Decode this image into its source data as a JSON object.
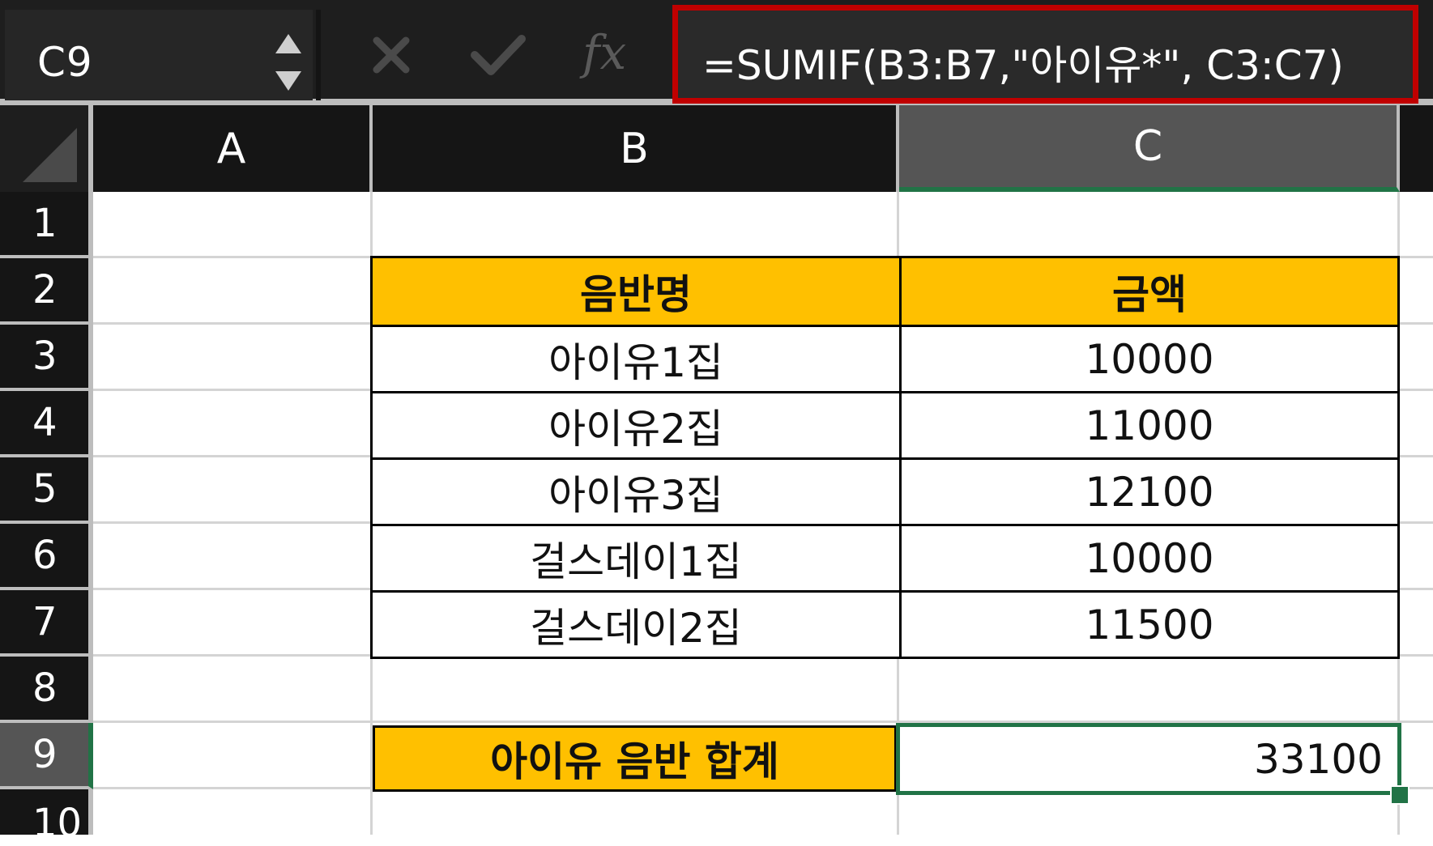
{
  "formula_bar": {
    "name_box": "C9",
    "formula": "=SUMIF(B3:B7,\"아이유*\", C3:C7)",
    "icons": [
      "cancel-icon",
      "enter-icon",
      "fx-icon"
    ]
  },
  "columns": [
    "A",
    "B",
    "C"
  ],
  "rows": [
    "1",
    "2",
    "3",
    "4",
    "5",
    "6",
    "7",
    "8",
    "9",
    "10"
  ],
  "table": {
    "headers": [
      "음반명",
      "금액"
    ],
    "rows": [
      [
        "아이유1집",
        "10000"
      ],
      [
        "아이유2집",
        "11000"
      ],
      [
        "아이유3집",
        "12100"
      ],
      [
        "걸스데이1집",
        "10000"
      ],
      [
        "걸스데이2집",
        "11500"
      ]
    ]
  },
  "summary": {
    "label": "아이유 음반 합계",
    "value": "33100"
  },
  "colors": {
    "header_fill": "#ffc000",
    "selection": "#217346",
    "formula_highlight": "#c00000"
  }
}
